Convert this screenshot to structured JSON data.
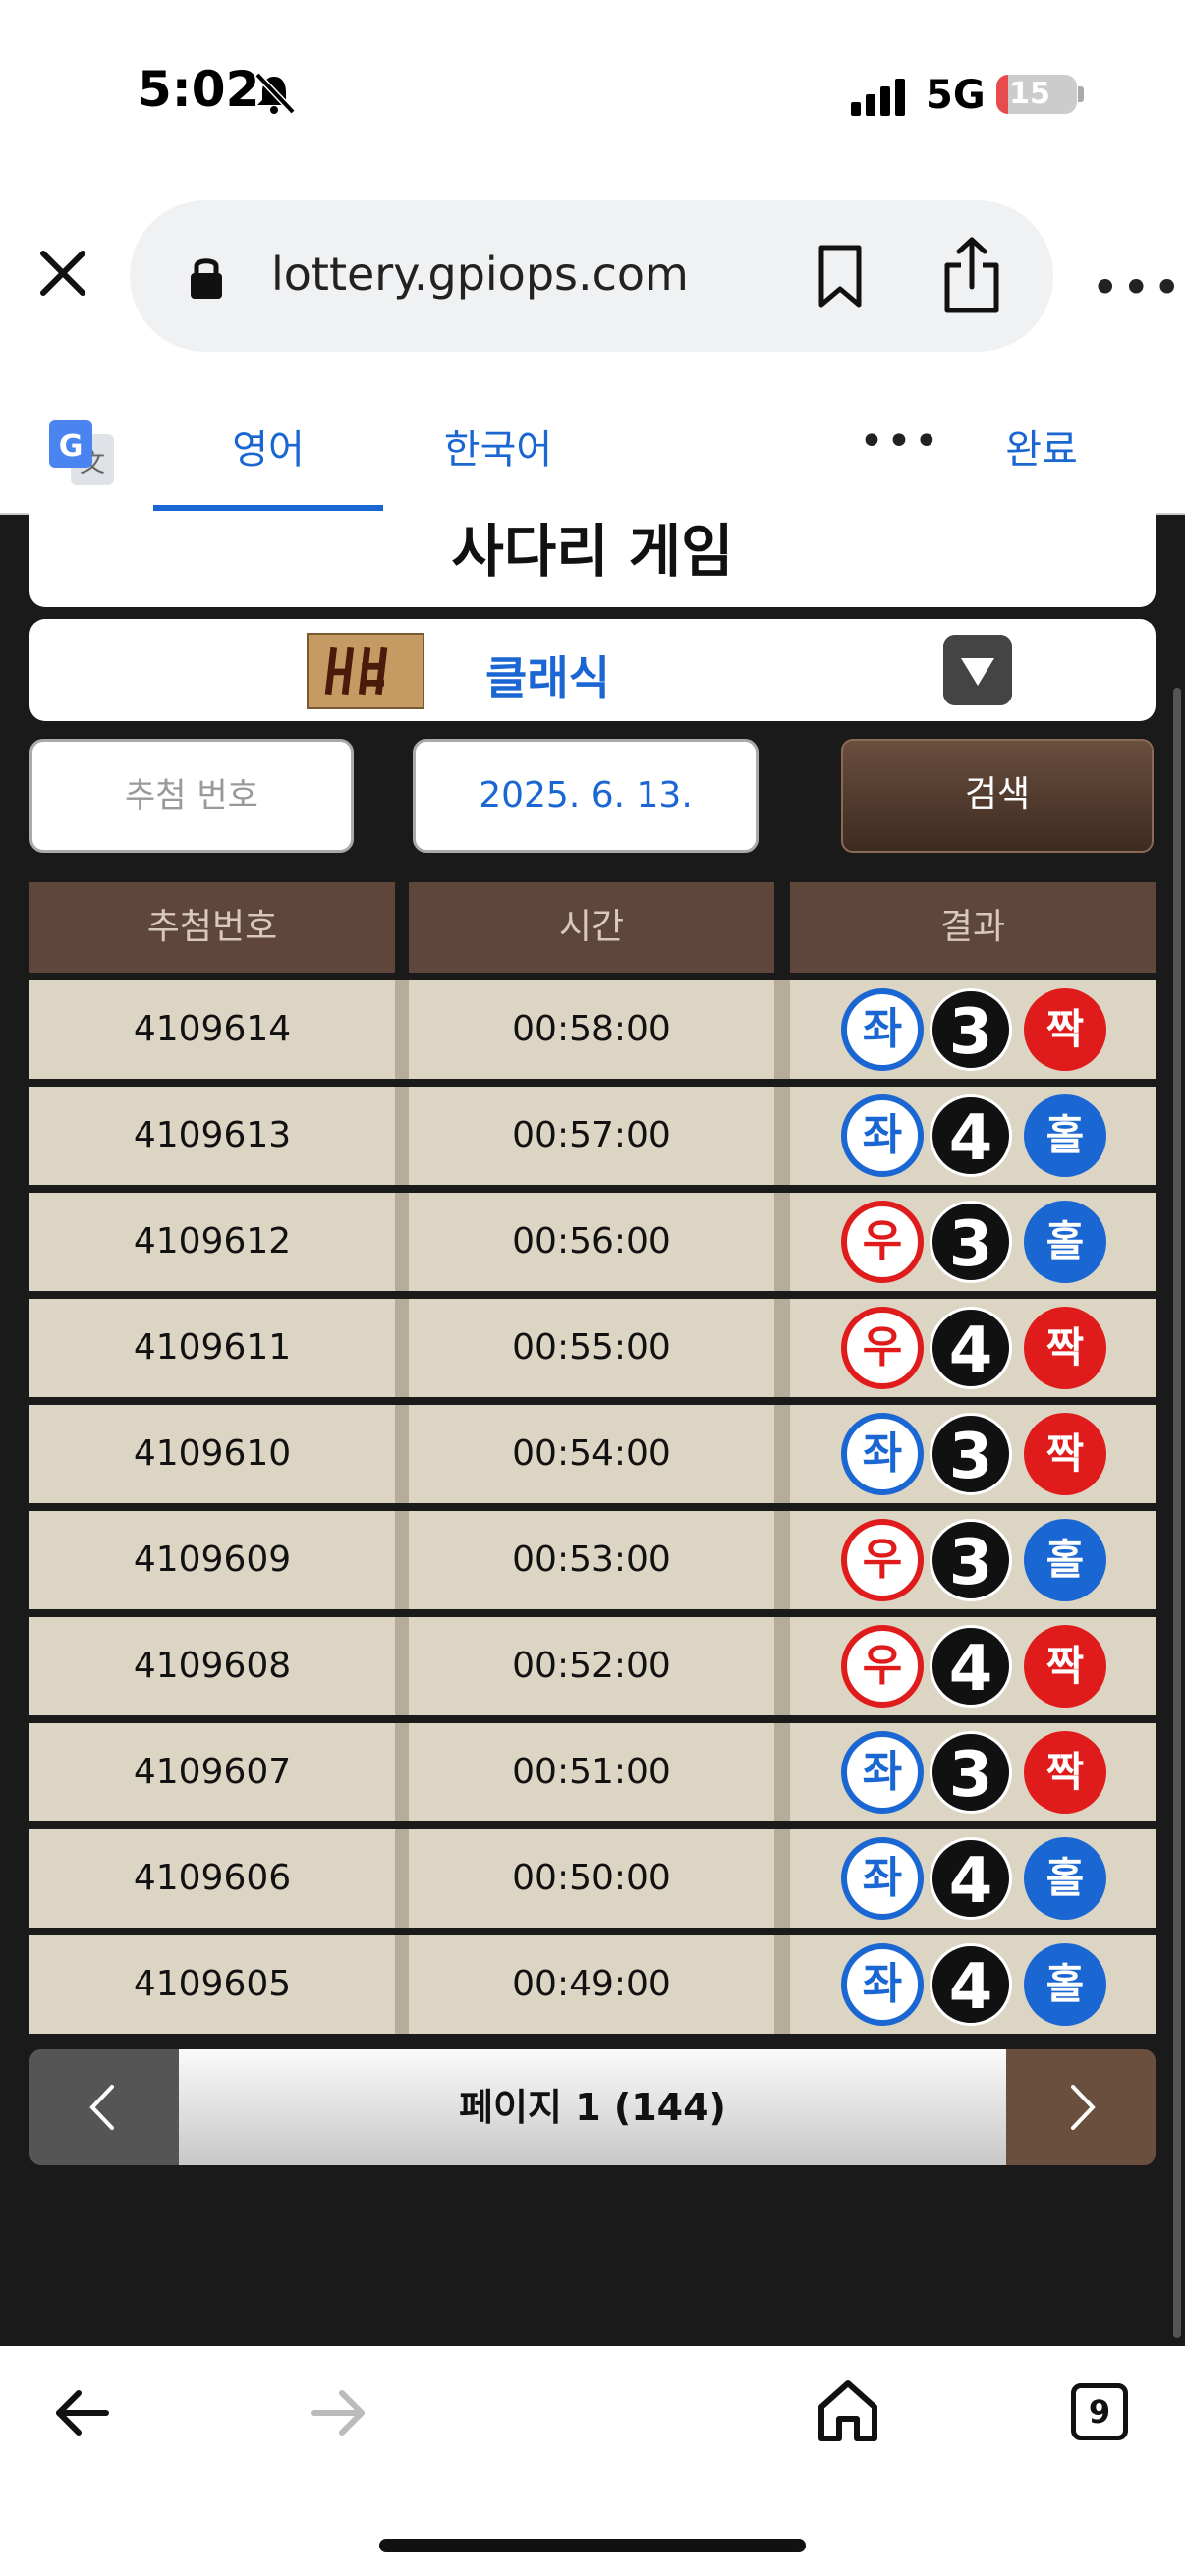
{
  "status": {
    "time": "5:02",
    "network": "5G",
    "battery": "15",
    "battery_level_percent": 15
  },
  "browser": {
    "url": "lottery.gpiops.com"
  },
  "translate_bar": {
    "tab_english": "영어",
    "tab_korean": "한국어",
    "done": "완료"
  },
  "page": {
    "title": "사다리 게임",
    "game_name": "클래식",
    "draw_number_placeholder": "추첨 번호",
    "date_value": "2025. 6. 13.",
    "search_label": "검색"
  },
  "table": {
    "headers": {
      "draw": "추첨번호",
      "time": "시간",
      "result": "결과"
    },
    "rows": [
      {
        "draw": "4109614",
        "time": "00:58:00",
        "side": "좌",
        "num": "3",
        "oe": "짝"
      },
      {
        "draw": "4109613",
        "time": "00:57:00",
        "side": "좌",
        "num": "4",
        "oe": "홀"
      },
      {
        "draw": "4109612",
        "time": "00:56:00",
        "side": "우",
        "num": "3",
        "oe": "홀"
      },
      {
        "draw": "4109611",
        "time": "00:55:00",
        "side": "우",
        "num": "4",
        "oe": "짝"
      },
      {
        "draw": "4109610",
        "time": "00:54:00",
        "side": "좌",
        "num": "3",
        "oe": "짝"
      },
      {
        "draw": "4109609",
        "time": "00:53:00",
        "side": "우",
        "num": "3",
        "oe": "홀"
      },
      {
        "draw": "4109608",
        "time": "00:52:00",
        "side": "우",
        "num": "4",
        "oe": "짝"
      },
      {
        "draw": "4109607",
        "time": "00:51:00",
        "side": "좌",
        "num": "3",
        "oe": "짝"
      },
      {
        "draw": "4109606",
        "time": "00:50:00",
        "side": "좌",
        "num": "4",
        "oe": "홀"
      },
      {
        "draw": "4109605",
        "time": "00:49:00",
        "side": "좌",
        "num": "4",
        "oe": "홀"
      }
    ]
  },
  "pager": {
    "label": "페이지 1 (144)"
  },
  "colors": {
    "left": "#1a66d2",
    "right": "#e01b1b",
    "even": "#e01b1b",
    "odd": "#1a66d2"
  },
  "nav": {
    "tabs_count": "9"
  }
}
